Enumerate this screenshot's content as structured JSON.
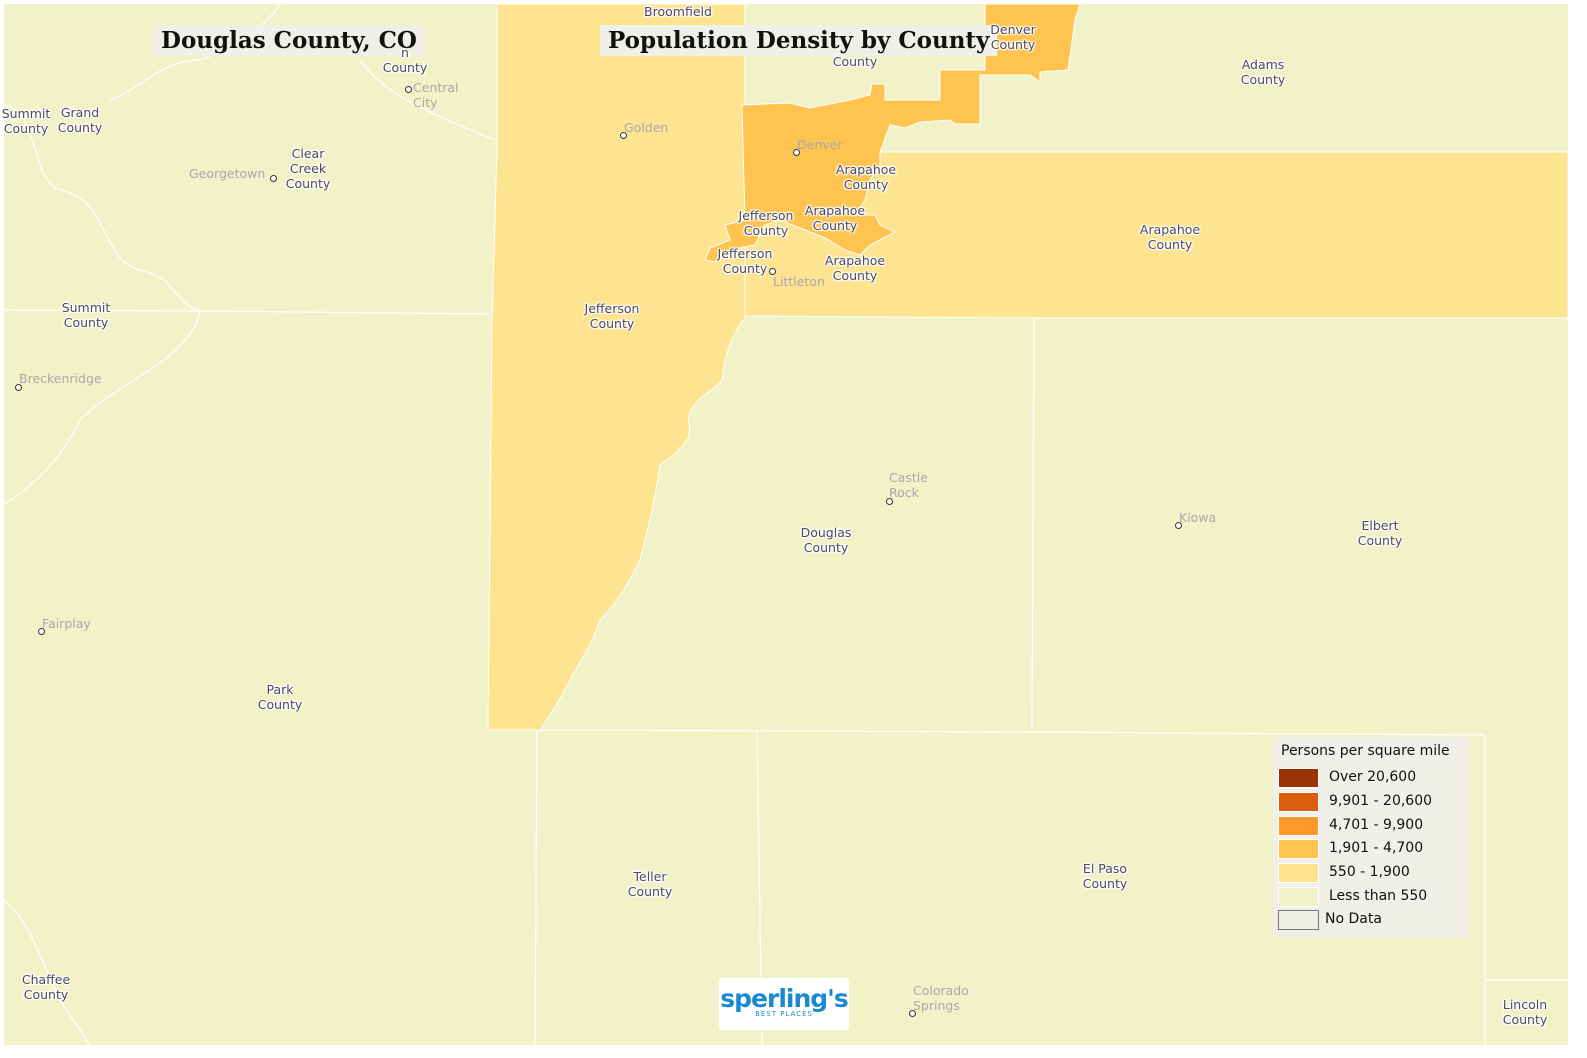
{
  "titles": {
    "left": "Douglas County, CO",
    "right": "Population Density by County"
  },
  "colors": {
    "over_20600": "#993404",
    "r9901_20600": "#d95f0e",
    "r4701_9900": "#fe9929",
    "r1901_4700": "#fec44f",
    "r550_1900": "#fee391",
    "less_550": "#f2f2c8",
    "no_data": "#f0efe8"
  },
  "county_labels": [
    "Broomfield",
    "Denver\nCounty",
    "Adams\nCounty",
    "County",
    "n\nCounty",
    "Summit\nCounty",
    "Grand\nCounty",
    "Clear\nCreek\nCounty",
    "Arapahoe\nCounty",
    "Jefferson\nCounty",
    "Arapahoe\nCounty",
    "Jefferson\nCounty",
    "Arapahoe\nCounty",
    "Arapahoe\nCounty",
    "Jefferson\nCounty",
    "Summit\nCounty",
    "Douglas\nCounty",
    "Elbert\nCounty",
    "Park\nCounty",
    "Teller\nCounty",
    "El Paso\nCounty",
    "Chaffee\nCounty",
    "Lincoln\nCounty"
  ],
  "cities": [
    "Central\nCity",
    "Golden",
    "Georgetown",
    "Denver",
    "Littleton",
    "Breckenridge",
    "Castle\nRock",
    "Kiowa",
    "Fairplay",
    "Colorado\nSprings"
  ],
  "legend": {
    "title": "Persons per square mile",
    "items": [
      {
        "label": "Over 20,600",
        "color": "#993404"
      },
      {
        "label": "9,901 - 20,600",
        "color": "#d95f0e"
      },
      {
        "label": "4,701 - 9,900",
        "color": "#fe9929"
      },
      {
        "label": "1,901 - 4,700",
        "color": "#fec44f"
      },
      {
        "label": "550 - 1,900",
        "color": "#fee391"
      },
      {
        "label": "Less than 550",
        "color": "#f2f2c8"
      },
      {
        "label": "No Data",
        "color": "#f0efe8"
      }
    ]
  },
  "logo": {
    "brand": "sperling's",
    "tagline": "BEST PLACES"
  }
}
